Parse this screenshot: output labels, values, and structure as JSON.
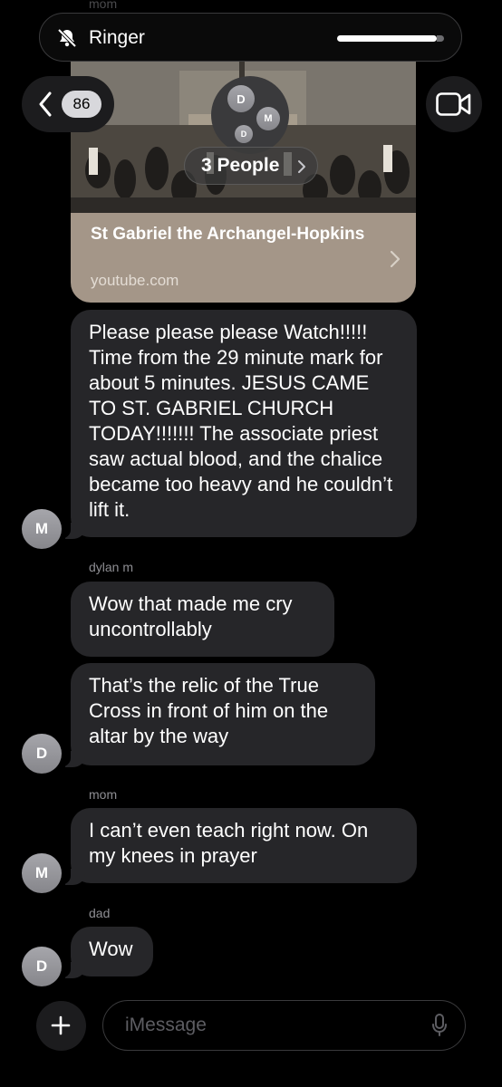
{
  "status": {
    "top_sender_partial": "mom"
  },
  "ringer": {
    "label": "Ringer",
    "icon": "bell-slash-icon",
    "level": 0.88
  },
  "header": {
    "unread_count": "86",
    "group_label": "3 People",
    "avatars": [
      "D",
      "M",
      "D"
    ]
  },
  "link_preview": {
    "title": "St Gabriel the Archangel-Hopkins",
    "domain": "youtube.com"
  },
  "messages": [
    {
      "sender": "",
      "avatar": "M",
      "text": "Please please please Watch!!!!! Time from the 29 minute mark for about 5 minutes. JESUS CAME TO ST. GABRIEL CHURCH TODAY!!!!!!!  The associate priest saw actual blood, and the chalice became too heavy and he couldn’t lift it."
    },
    {
      "sender": "dylan m",
      "avatar": "",
      "text": "Wow that made me cry uncontrollably"
    },
    {
      "sender": "",
      "avatar": "D",
      "text": "That’s the relic of the True Cross in front of him on the altar by the way"
    },
    {
      "sender": "mom",
      "avatar": "M",
      "text": "I can’t even teach right now. On my knees in prayer"
    },
    {
      "sender": "dad",
      "avatar": "D",
      "text": "Wow"
    }
  ],
  "composer": {
    "placeholder": "iMessage"
  }
}
